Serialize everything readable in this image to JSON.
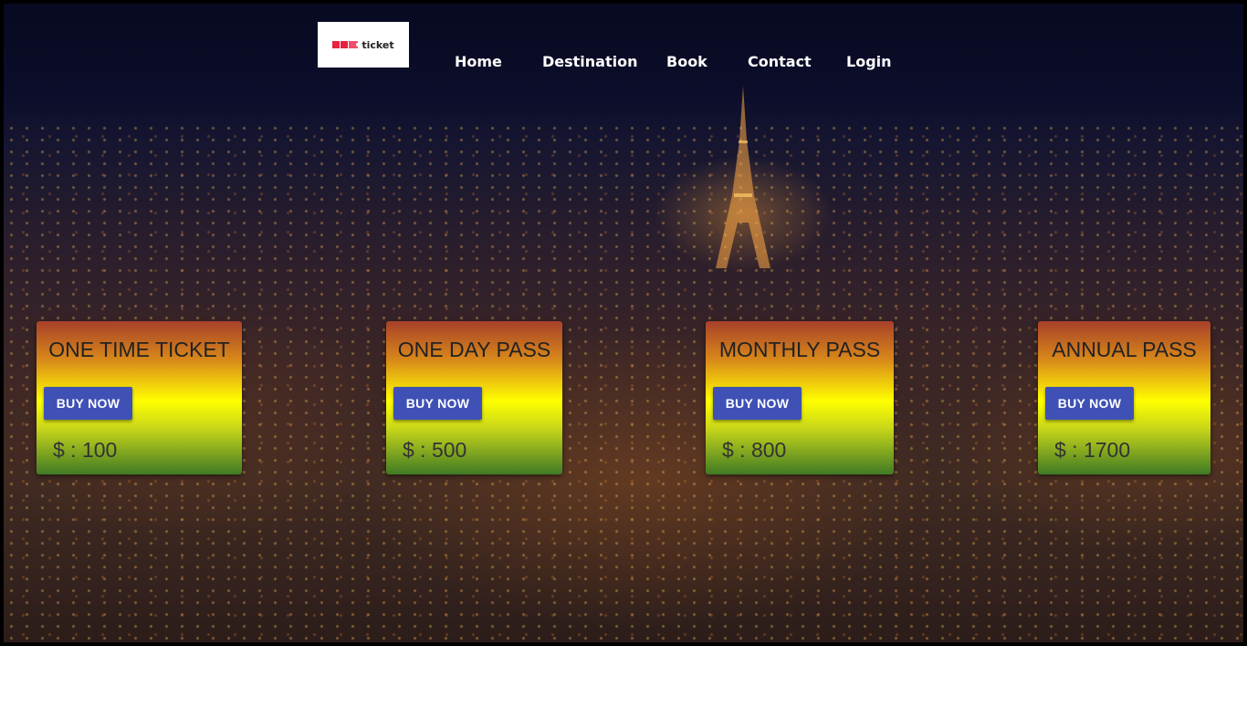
{
  "brand": {
    "logo_text": "ticket"
  },
  "nav": {
    "items": [
      "Home",
      "Destination",
      "Book",
      "Contact",
      "Login"
    ]
  },
  "cards": [
    {
      "title": "ONE TIME TICKET",
      "button": "BUY NOW",
      "price": "$ : 100"
    },
    {
      "title": "ONE DAY PASS",
      "button": "BUY NOW",
      "price": "$ : 500"
    },
    {
      "title": "MONTHLY PASS",
      "button": "BUY NOW",
      "price": "$ : 800"
    },
    {
      "title": "ANNUAL PASS",
      "button": "BUY NOW",
      "price": "$ : 1700"
    }
  ],
  "colors": {
    "button": "#3f51b5",
    "card_gradient": [
      "#a8402a",
      "#ffff00",
      "#3f7a24"
    ]
  }
}
